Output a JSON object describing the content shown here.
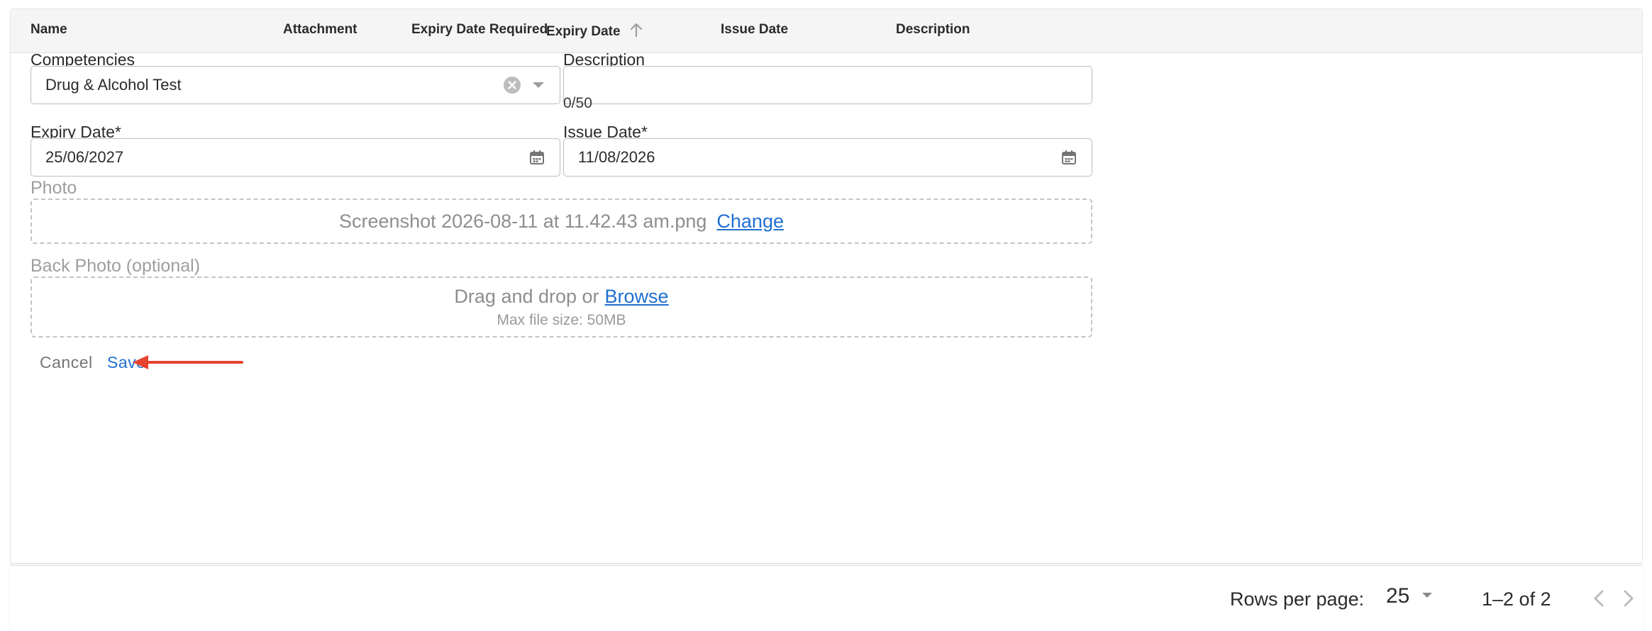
{
  "table": {
    "columns": [
      {
        "label": "Name"
      },
      {
        "label": "Attachment"
      },
      {
        "label": "Expiry Date Required"
      },
      {
        "label": "Expiry Date",
        "sort": "ascending",
        "icon": "arrow-up-icon"
      },
      {
        "label": "Issue Date"
      },
      {
        "label": "Description"
      }
    ]
  },
  "form": {
    "competencies": {
      "label": "Competencies",
      "value": "Drug & Alcohol Test",
      "icons": [
        "clear-icon",
        "chevron-down-icon"
      ]
    },
    "description": {
      "label": "Description",
      "value": "",
      "counter": "0/50"
    },
    "expiry_date": {
      "label": "Expiry Date",
      "required_mark": "*",
      "value": "25/06/2027",
      "icon": "calendar-icon"
    },
    "issue_date": {
      "label": "Issue Date",
      "required_mark": "*",
      "value": "11/08/2026",
      "icon": "calendar-icon"
    },
    "photo": {
      "label": "Photo",
      "filename": "Screenshot 2026-08-11 at 11.42.43 am.png",
      "change_label": "Change"
    },
    "back_photo": {
      "label": "Back Photo (optional)",
      "prompt": "Drag and drop or",
      "browse_label": "Browse",
      "max_size": "Max file size: 50MB"
    },
    "actions": {
      "cancel_label": "Cancel",
      "save_label": "Save"
    }
  },
  "annotation": {
    "type": "red-arrow",
    "points_to": "save-button",
    "color": "#e8432d"
  },
  "footer": {
    "rows_per_page_label": "Rows per page:",
    "rows_per_page_value": "25",
    "range": "1–2 of 2"
  },
  "colors": {
    "link": "#1f6fd1",
    "header_bg": "#f5f5f5",
    "border": "#bdbdbd"
  }
}
